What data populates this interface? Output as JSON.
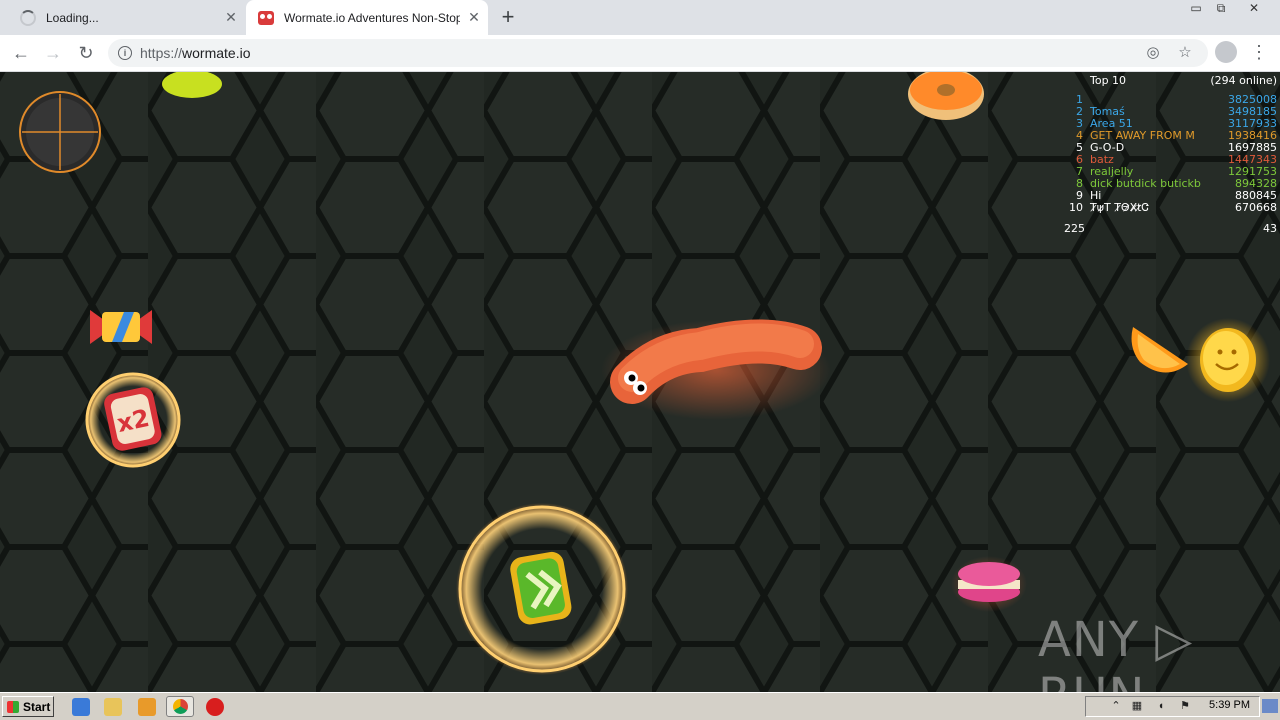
{
  "browser": {
    "tabs": [
      {
        "title": "Loading...",
        "state": "loading"
      },
      {
        "title": "Wormate.io Adventures Non-Stop",
        "state": "active"
      }
    ],
    "url_protocol": "https://",
    "url_host": "wormate.io",
    "close_glyph": "✕",
    "new_tab_glyph": "+",
    "window_controls": [
      "▭",
      "⧉",
      "✕"
    ]
  },
  "game": {
    "leaderboard": {
      "title": "Top 10",
      "online": "(294 online)",
      "rows": [
        {
          "rank": "1",
          "name": "",
          "score": "3825008",
          "color": "#3ba7e8"
        },
        {
          "rank": "2",
          "name": "Tomaś",
          "score": "3498185",
          "color": "#3ba7e8"
        },
        {
          "rank": "3",
          "name": "Area 51",
          "score": "3117933",
          "color": "#3ba7e8"
        },
        {
          "rank": "4",
          "name": "GET AWAY FROM M",
          "score": "1938416",
          "color": "#e09a2a"
        },
        {
          "rank": "5",
          "name": "G-O-D",
          "score": "1697885",
          "color": "#ffffff"
        },
        {
          "rank": "6",
          "name": "batz",
          "score": "1447343",
          "color": "#e05a3a"
        },
        {
          "rank": "7",
          "name": "realjelly",
          "score": "1291753",
          "color": "#7ec93a"
        },
        {
          "rank": "8",
          "name": "dick butdick butickb",
          "score": "894328",
          "color": "#7ec93a"
        },
        {
          "rank": "9",
          "name": "Hi",
          "score": "880845",
          "color": "#ffffff"
        },
        {
          "rank": "10",
          "name": "T̷ψ̷T T̷Θ̷X̷t̷Ꮳ",
          "score": "670668",
          "color": "#ffffff"
        }
      ],
      "footer_left": "225",
      "footer_right": "43"
    },
    "watermark": "ANY ▷ RUN",
    "powerups": [
      "x2 multiplier",
      "speed boost"
    ],
    "foods": [
      "donut",
      "candy",
      "orange slice",
      "coin",
      "macaron",
      "jelly"
    ]
  },
  "taskbar": {
    "start_label": "Start",
    "clock": "5:39 PM"
  }
}
